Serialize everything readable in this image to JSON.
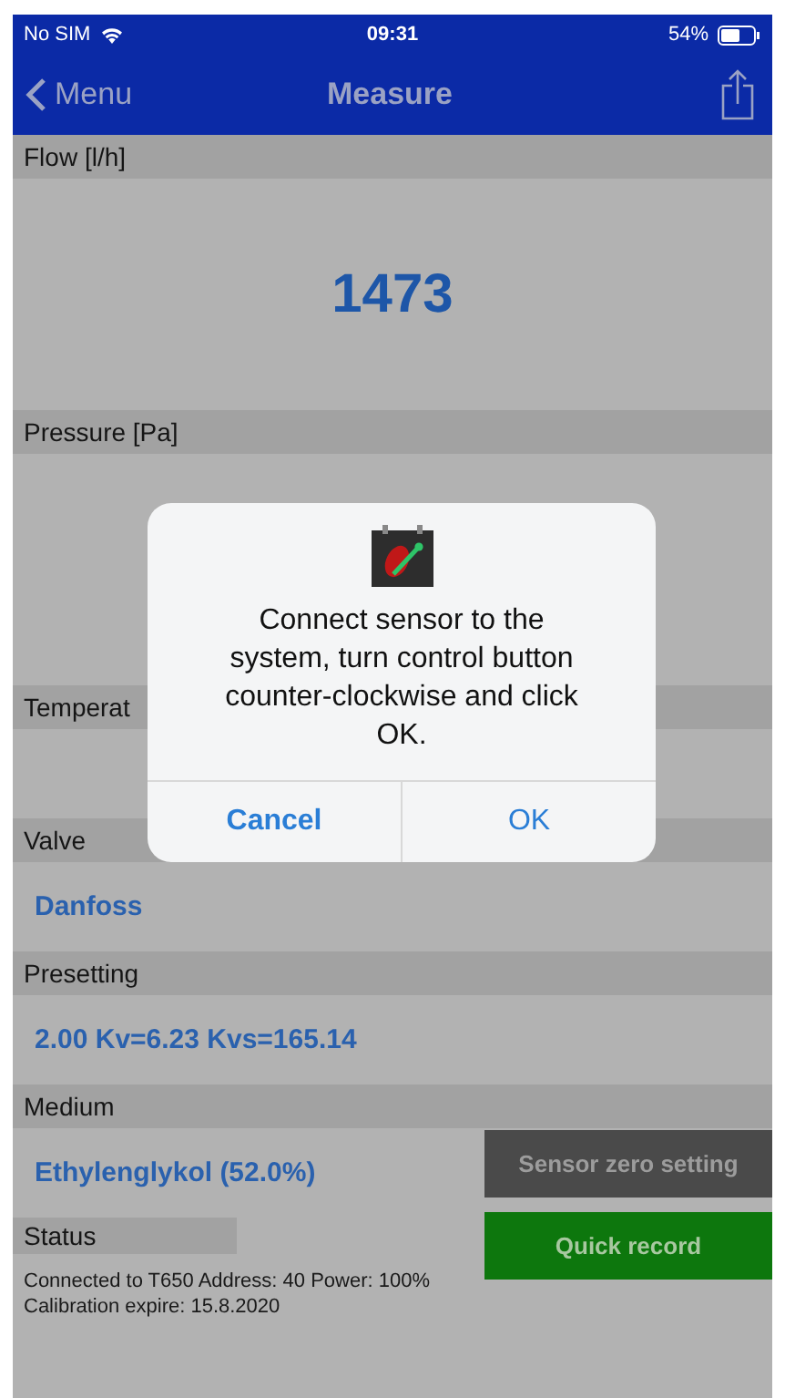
{
  "status_bar": {
    "carrier": "No SIM",
    "time": "09:31",
    "battery": "54%"
  },
  "nav": {
    "back": "Menu",
    "title": "Measure"
  },
  "sections": [
    {
      "label": "Flow [l/h]",
      "kind": "large",
      "value": "1473"
    },
    {
      "label": "Pressure [Pa]",
      "kind": "large"
    },
    {
      "label": "Temperat",
      "kind": "line"
    },
    {
      "label": "Valve",
      "kind": "line",
      "value": "Danfoss"
    },
    {
      "label": "Presetting",
      "kind": "line",
      "value": "2.00 Kv=6.23 Kvs=165.14"
    }
  ],
  "medium": {
    "label": "Medium",
    "value": "Ethylenglykol (52.0%)"
  },
  "status": {
    "label": "Status",
    "text": "Connected to T650 Address: 40 Power: 100% Calibration expire: 15.8.2020"
  },
  "actions": [
    {
      "label": "Sensor zero setting",
      "kind": "dark"
    },
    {
      "label": "Quick record",
      "kind": "green"
    }
  ],
  "dialog": {
    "message": "Connect sensor to the system, turn control button counter-clockwise and click OK.",
    "buttons": [
      {
        "label": "Cancel",
        "kind": "bold"
      },
      {
        "label": "OK",
        "kind": "plain"
      }
    ]
  }
}
